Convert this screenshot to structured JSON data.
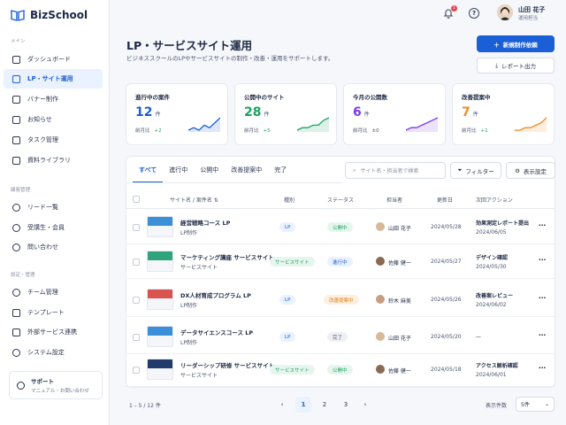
{
  "app": {
    "name": "BizSchool"
  },
  "sidebar": {
    "sections": [
      {
        "label": "メイン",
        "items": [
          {
            "label": "ダッシュボード",
            "icon": "dashboard-icon"
          },
          {
            "label": "LP・サイト運用",
            "icon": "monitor-icon",
            "active": true
          },
          {
            "label": "バナー制作",
            "icon": "image-icon"
          },
          {
            "label": "お知らせ",
            "icon": "megaphone-icon"
          },
          {
            "label": "タスク管理",
            "icon": "calendar-check-icon"
          },
          {
            "label": "資料ライブラリ",
            "icon": "document-icon"
          }
        ]
      },
      {
        "label": "顧客管理",
        "items": [
          {
            "label": "リード一覧",
            "icon": "people-icon"
          },
          {
            "label": "受講生・会員",
            "icon": "user-icon"
          },
          {
            "label": "問い合わせ",
            "icon": "chat-icon"
          }
        ]
      },
      {
        "label": "設定・管理",
        "items": [
          {
            "label": "チーム管理",
            "icon": "team-icon"
          },
          {
            "label": "テンプレート",
            "icon": "template-icon"
          },
          {
            "label": "外部サービス連携",
            "icon": "link-icon"
          },
          {
            "label": "システム設定",
            "icon": "gear-icon"
          }
        ]
      }
    ],
    "support": {
      "title": "サポート",
      "subtitle": "マニュアル・お問い合わせ"
    }
  },
  "topbar": {
    "notification_count": "1",
    "help_label": "?",
    "user_name": "山田 花子",
    "user_role": "運用担当"
  },
  "header": {
    "title": "LP・サービスサイト運用",
    "subtitle": "ビジネススクールのLPやサービスサイトの制作・改善・運用をサポートします。",
    "primary_button": "新規制作依頼",
    "secondary_button": "レポート出力"
  },
  "kpis": [
    {
      "label": "進行中の案件",
      "value": "12",
      "unit": "件",
      "compare_label": "前月比",
      "delta": "+2",
      "color": "#1b5fd6",
      "spark": [
        3,
        4,
        3,
        5,
        4,
        6,
        8
      ]
    },
    {
      "label": "公開中のサイト",
      "value": "28",
      "unit": "件",
      "compare_label": "前月比",
      "delta": "+5",
      "color": "#19a463",
      "spark": [
        3,
        4,
        4,
        5,
        5,
        7,
        8
      ]
    },
    {
      "label": "今月の公開数",
      "value": "6",
      "unit": "件",
      "compare_label": "前月比",
      "delta": "±0",
      "color": "#7c3aed",
      "spark": [
        2,
        3,
        3,
        4,
        5,
        6,
        7
      ]
    },
    {
      "label": "改善提案中",
      "value": "7",
      "unit": "件",
      "compare_label": "前月比",
      "delta": "+1",
      "color": "#f08a24",
      "spark": [
        3,
        3,
        4,
        4,
        5,
        6,
        8
      ]
    }
  ],
  "tabs": [
    "すべて",
    "進行中",
    "公開中",
    "改善提案中",
    "完了"
  ],
  "search": {
    "placeholder": "サイト名・担当者で検索"
  },
  "toolbar": {
    "filter_label": "フィルター",
    "display_settings_label": "表示設定"
  },
  "table": {
    "columns": [
      "サイト名 / 案件名",
      "種別",
      "ステータス",
      "担当者",
      "更新日",
      "次回アクション"
    ],
    "rows": [
      {
        "title": "経営戦略コース LP",
        "category": "LP制作",
        "type": "LP",
        "status": "公開中",
        "assignee": "山田 花子",
        "updated": "2024/05/28",
        "next_action": "効果測定レポート提出",
        "next_date": "2024/06/05",
        "thumb_color": "#3a8fd8"
      },
      {
        "title": "マーケティング講座 サービスサイト",
        "category": "サービスサイト",
        "type": "サービスサイト",
        "status": "進行中",
        "assignee": "佐藤 健一",
        "updated": "2024/05/27",
        "next_action": "デザイン確認",
        "next_date": "2024/05/30",
        "thumb_color": "#2fa37a"
      },
      {
        "title": "DX人材育成プログラム LP",
        "category": "LP制作",
        "type": "LP",
        "status": "改善提案中",
        "assignee": "鈴木 麻美",
        "updated": "2024/05/26",
        "next_action": "改善案レビュー",
        "next_date": "2024/06/02",
        "thumb_color": "#d9534f"
      },
      {
        "title": "データサイエンスコース LP",
        "category": "LP制作",
        "type": "LP",
        "status": "完了",
        "assignee": "山田 花子",
        "updated": "2024/05/20",
        "next_action": "—",
        "next_date": "",
        "thumb_color": "#3a8fd8"
      },
      {
        "title": "リーダーシップ研修 サービスサイト",
        "category": "サービスサイト",
        "type": "サービスサイト",
        "status": "公開中",
        "assignee": "佐藤 健一",
        "updated": "2024/05/18",
        "next_action": "アクセス解析確認",
        "next_date": "2024/06/01",
        "thumb_color": "#1f3a6b"
      }
    ]
  },
  "pagination": {
    "info": "1 – 5 / 12 件",
    "pages": [
      "1",
      "2",
      "3"
    ],
    "prev": "‹",
    "next": "›",
    "page_size_label": "表示件数",
    "page_size": "5件"
  }
}
